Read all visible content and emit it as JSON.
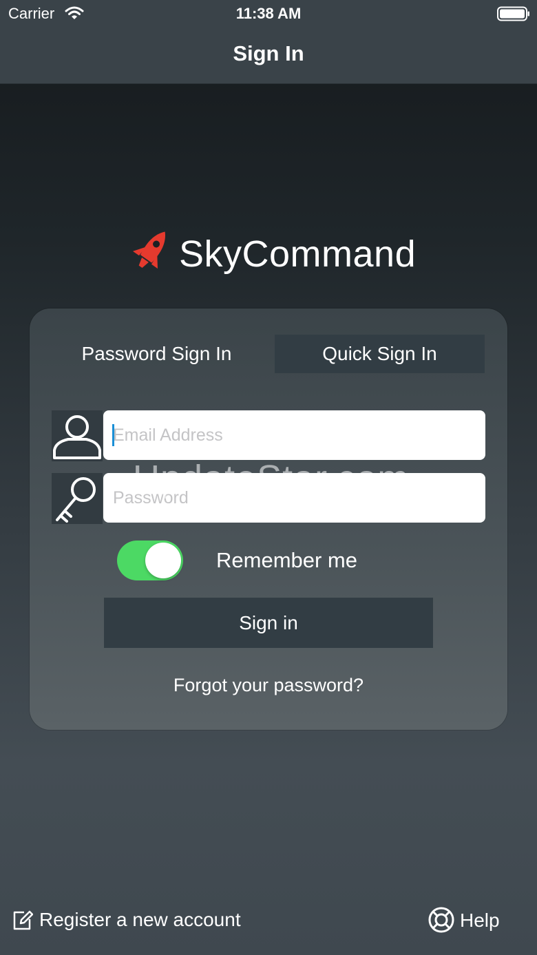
{
  "status_bar": {
    "carrier": "Carrier",
    "time": "11:38 AM"
  },
  "nav": {
    "title": "Sign In"
  },
  "logo": {
    "text": "SkyCommand"
  },
  "tabs": [
    {
      "label": "Password Sign In",
      "selected": true
    },
    {
      "label": "Quick Sign In",
      "selected": false
    }
  ],
  "form": {
    "email_placeholder": "Email Address",
    "email_value": "",
    "password_placeholder": "Password",
    "password_value": "",
    "remember_label": "Remember me",
    "remember_on": true,
    "signin_label": "Sign in",
    "forgot_label": "Forgot your password?"
  },
  "watermark": "UpdateStar.com",
  "footer": {
    "register_label": "Register a new account",
    "help_label": "Help"
  },
  "colors": {
    "toggle_on": "#4cd964",
    "rocket": "#e53a2e",
    "selected_tab_bg": "#323d44",
    "cursor": "#1a8fd6"
  },
  "icons": [
    "wifi-icon",
    "battery-icon",
    "rocket-icon",
    "user-icon",
    "key-icon",
    "edit-icon",
    "lifebuoy-icon"
  ]
}
